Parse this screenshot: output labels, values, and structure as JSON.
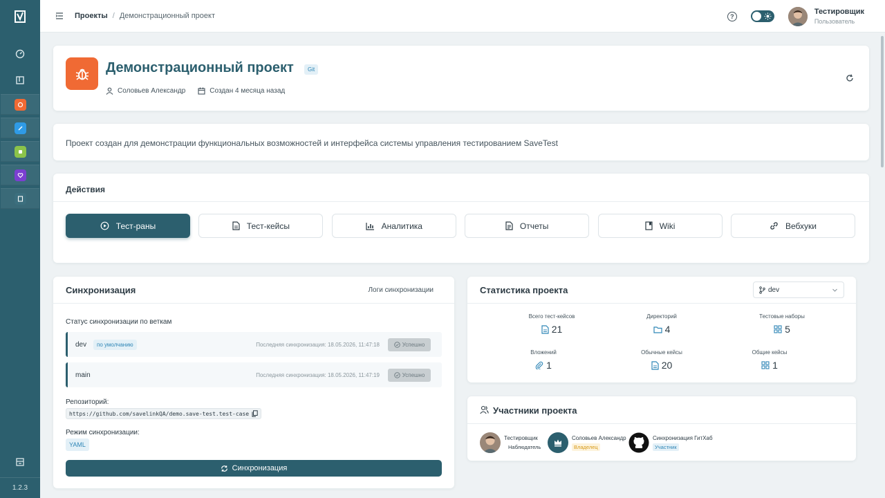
{
  "app": {
    "version": "1.2.3"
  },
  "breadcrumb": {
    "root": "Проекты",
    "separator": "/",
    "current": "Демонстрационный проект"
  },
  "user": {
    "name": "Тестировщик",
    "role": "Пользователь"
  },
  "project": {
    "title": "Демонстрационный проект",
    "badge": "Git",
    "author": "Соловьев Александр",
    "created": "Создан 4 месяца назад",
    "description": "Проект создан для демонстрации функциональных возможностей и интерфейса системы управления тестированием SaveTest"
  },
  "actions": {
    "title": "Действия",
    "buttons": [
      {
        "label": "Тест-раны",
        "icon": "play-circle-icon"
      },
      {
        "label": "Тест-кейсы",
        "icon": "document-icon"
      },
      {
        "label": "Аналитика",
        "icon": "bar-chart-icon"
      },
      {
        "label": "Отчеты",
        "icon": "report-icon"
      },
      {
        "label": "Wiki",
        "icon": "book-icon"
      },
      {
        "label": "Вебхуки",
        "icon": "link-icon"
      }
    ]
  },
  "sync": {
    "title": "Синхронизация",
    "logs_link": "Логи синхронизации",
    "branches_title": "Статус синхронизации по веткам",
    "branches": [
      {
        "name": "dev",
        "badge": "по умолчанию",
        "last_sync": "Последняя синхронизация: 18.05.2026, 11:47:18",
        "status": "Успешно"
      },
      {
        "name": "main",
        "last_sync": "Последняя синхронизация: 18.05.2026, 11:47:19",
        "status": "Успешно"
      }
    ],
    "repo_label": "Репозиторий:",
    "repo_url": "https://github.com/savelinkQA/demo.save-test.test-case",
    "mode_label": "Режим синхронизации:",
    "mode_value": "YAML",
    "button_label": "Синхронизация"
  },
  "stats": {
    "title": "Статистика проекта",
    "branch_selected": "dev",
    "items": [
      {
        "label": "Всего тест-кейсов",
        "value": "21",
        "icon": "document-icon"
      },
      {
        "label": "Директорий",
        "value": "4",
        "icon": "folder-icon"
      },
      {
        "label": "Тестовые наборы",
        "value": "5",
        "icon": "grid-icon"
      },
      {
        "label": "Вложений",
        "value": "1",
        "icon": "paperclip-icon"
      },
      {
        "label": "Обычные кейсы",
        "value": "20",
        "icon": "document-icon"
      },
      {
        "label": "Общие кейсы",
        "value": "1",
        "icon": "grid-icon"
      }
    ]
  },
  "members": {
    "title": "Участники проекта",
    "list": [
      {
        "name": "Тестировщик",
        "role": "Наблюдатель"
      },
      {
        "name": "Соловьев Александр",
        "role": "Владелец"
      },
      {
        "name": "Синхронизация ГитХаб",
        "role": "Участник"
      }
    ]
  },
  "colors": {
    "primary": "#2c5f6e",
    "accent_orange": "#f06a34",
    "badge_blue": "#2f86b6",
    "owner": "#d79a1a"
  }
}
